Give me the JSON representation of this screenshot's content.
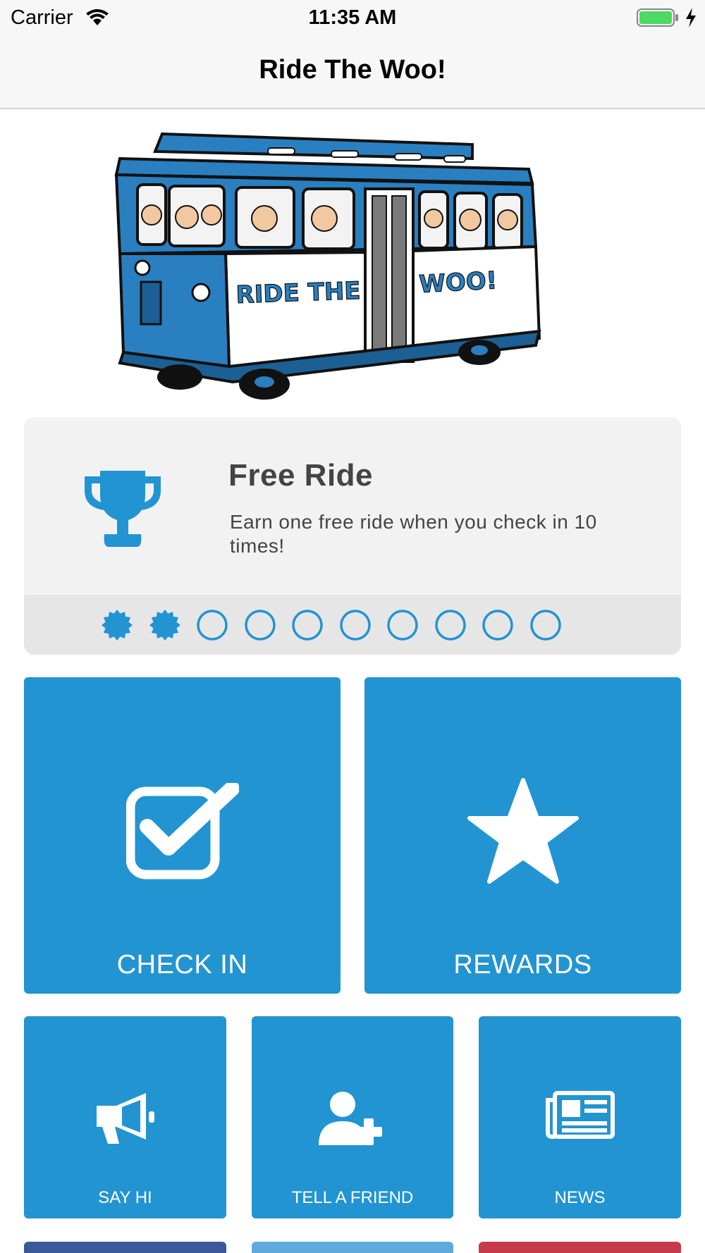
{
  "status_bar": {
    "carrier": "Carrier",
    "time": "11:35 AM"
  },
  "nav": {
    "title": "Ride The Woo!"
  },
  "hero": {
    "sign_text_left": "RIDE THE",
    "sign_text_right": "WOO!"
  },
  "reward": {
    "title": "Free Ride",
    "description": "Earn one free ride when you check in 10 times!",
    "punches_total": 10,
    "punches_filled": 2
  },
  "tiles": {
    "check_in": "CHECK IN",
    "rewards": "REWARDS",
    "say_hi": "SAY HI",
    "tell_a_friend": "TELL A FRIEND",
    "news": "NEWS"
  },
  "colors": {
    "accent": "#2294d2",
    "facebook": "#3b5998",
    "twitter": "#5fa9dd",
    "pinterest": "#c63b4a"
  },
  "icons": [
    "wifi-icon",
    "battery-icon",
    "charging-icon",
    "trophy-icon",
    "checkbox-icon",
    "star-icon",
    "megaphone-icon",
    "add-user-icon",
    "newspaper-icon"
  ]
}
